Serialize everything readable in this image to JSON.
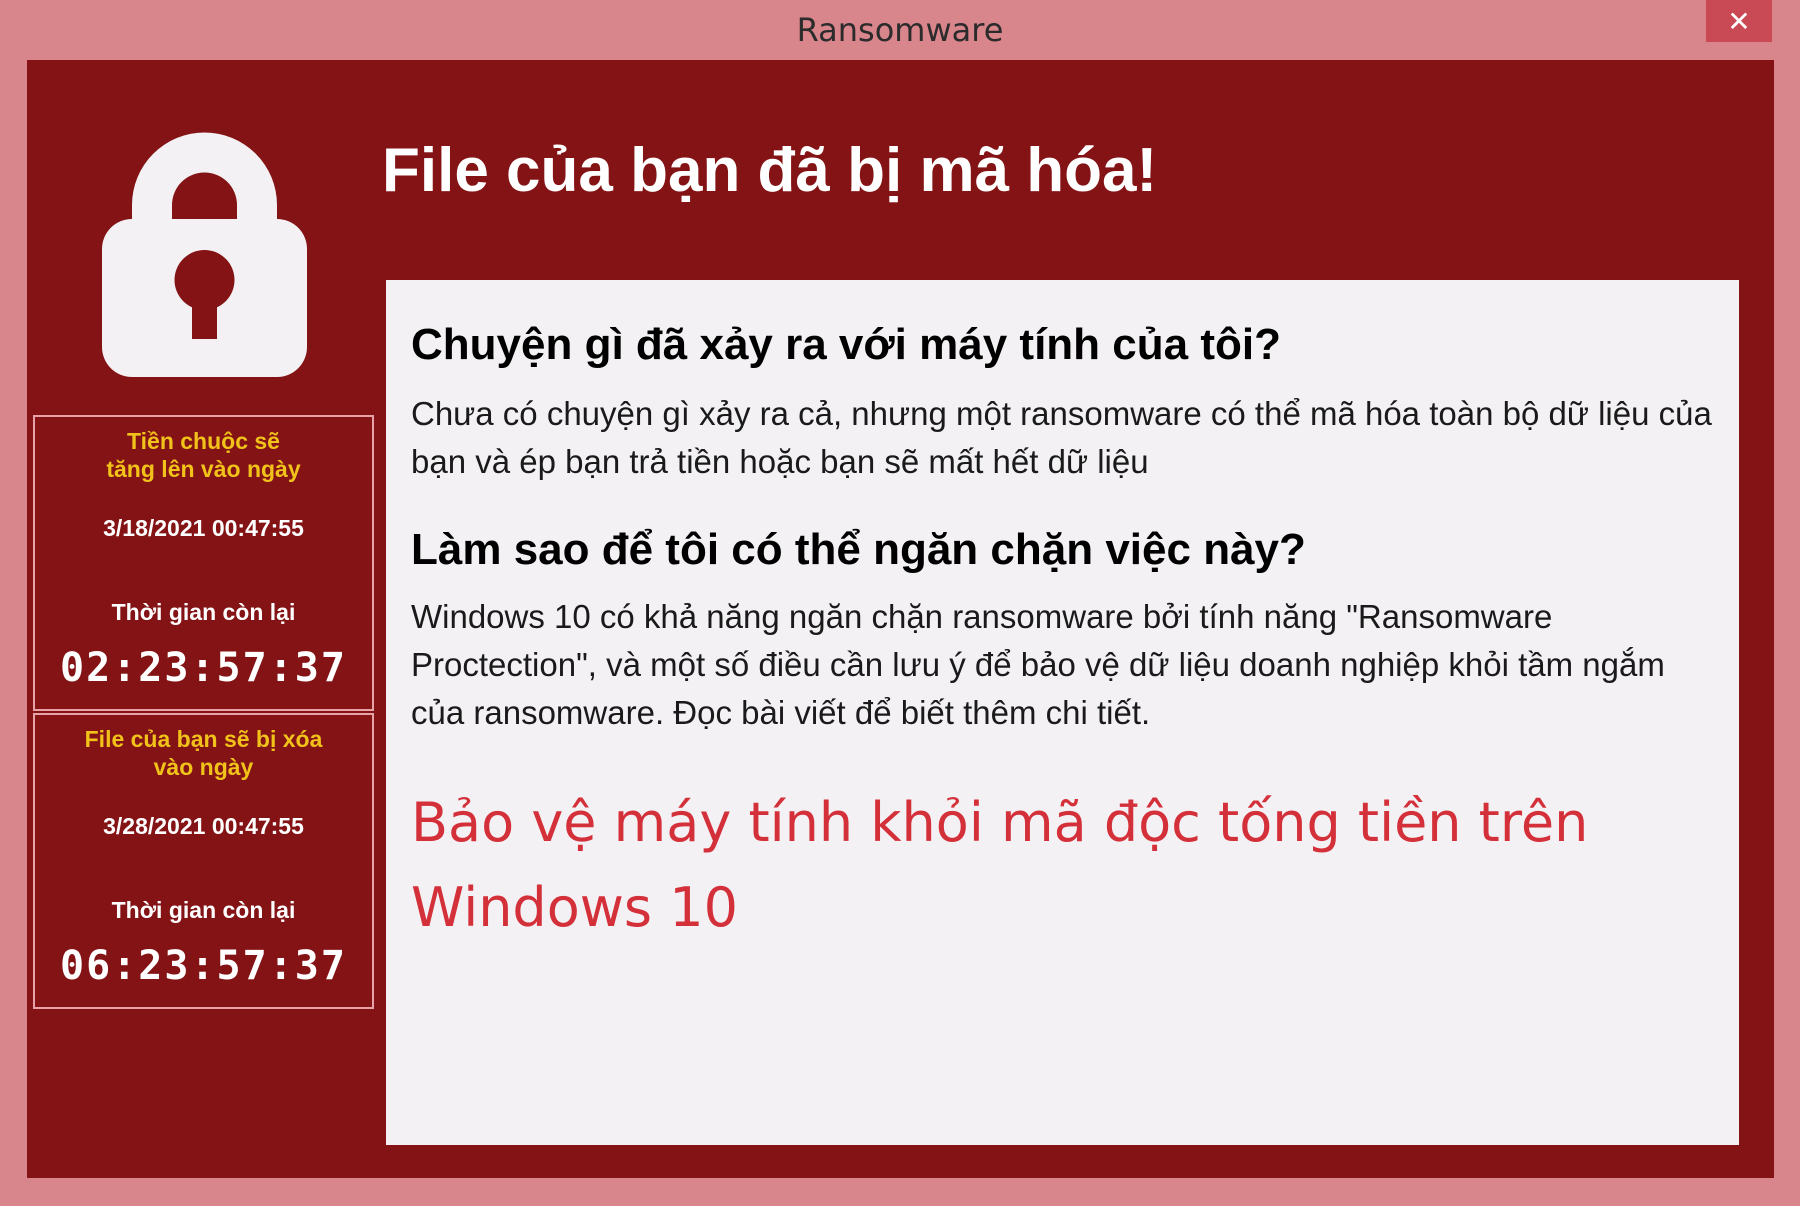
{
  "window": {
    "title": "Ransomware",
    "close_label": "✕"
  },
  "headline": "File của bạn đã bị mã hóa!",
  "panels": [
    {
      "heading": "Tiền chuộc sẽ\ntăng lên vào ngày",
      "date": "3/18/2021 00:47:55",
      "remaining_label": "Thời gian còn lại",
      "countdown": "02:23:57:37"
    },
    {
      "heading": "File của bạn sẽ bị xóa\nvào ngày",
      "date": "3/28/2021 00:47:55",
      "remaining_label": "Thời gian còn lại",
      "countdown": "06:23:57:37"
    }
  ],
  "content": {
    "q1": "Chuyện gì đã xảy ra với máy tính của tôi?",
    "a1": "Chưa có chuyện gì xảy ra cả, nhưng một ransomware có thể mã hóa toàn bộ dữ liệu của bạn và ép bạn trả tiền hoặc bạn sẽ mất hết dữ liệu",
    "q2": "Làm sao để tôi có thể ngăn chặn việc này?",
    "a2": "Windows 10 có khả năng ngăn chặn ransomware bởi tính năng \"Ransomware Proctection\", và một số điều cần lưu ý để bảo vệ dữ liệu doanh nghiệp khỏi tầm ngắm của ransomware. Đọc bài viết để biết thêm chi tiết.",
    "link": "Bảo vệ máy tính khỏi mã độc tống tiền trên Windows 10"
  },
  "icons": {
    "lock": "padlock-icon",
    "close": "close-icon"
  },
  "colors": {
    "window_frame": "#d9858c",
    "panel_background": "#841315",
    "content_background": "#f3f1f4",
    "panel_heading": "#f0c21a",
    "link": "#d4303a",
    "close_button": "#c94a55"
  }
}
